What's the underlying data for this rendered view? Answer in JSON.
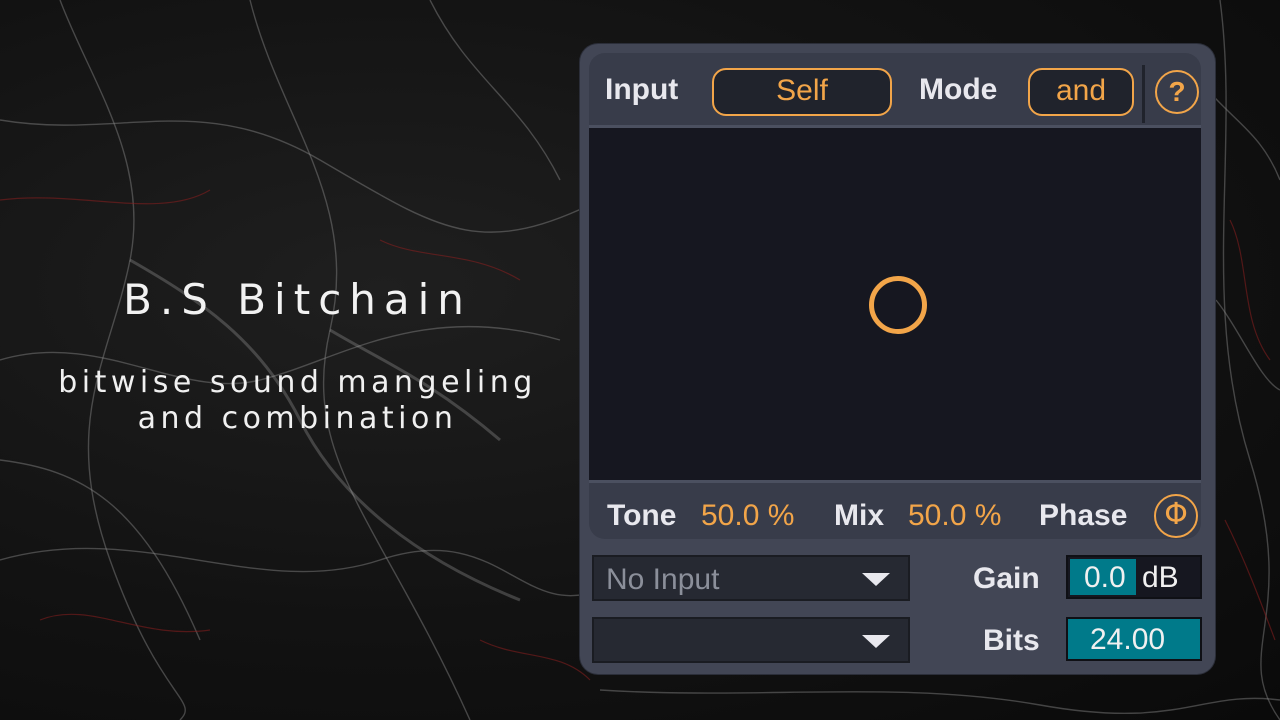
{
  "promo": {
    "title": "B.S Bitchain",
    "subtitle_line1": "bitwise sound mangeling",
    "subtitle_line2": "and combination"
  },
  "device": {
    "input_label": "Input",
    "input_value": "Self",
    "mode_label": "Mode",
    "mode_value": "and",
    "help_glyph": "?",
    "tone_label": "Tone",
    "tone_value": "50.0 %",
    "mix_label": "Mix",
    "mix_value": "50.0 %",
    "phase_label": "Phase",
    "phase_glyph": "Φ",
    "dropdown1_value": "No Input",
    "dropdown2_value": "",
    "gain_label": "Gain",
    "gain_value": "0.0",
    "gain_unit": "dB",
    "bits_label": "Bits",
    "bits_value": "24.00"
  },
  "colors": {
    "accent": "#f2a549",
    "numbox_fill": "#007a8a",
    "panel_bg": "#383c4a",
    "scope_bg": "#161720"
  },
  "icons": {
    "help": "question-circle-icon",
    "phase": "phase-invert-icon",
    "dropdown": "chevron-down-icon"
  }
}
